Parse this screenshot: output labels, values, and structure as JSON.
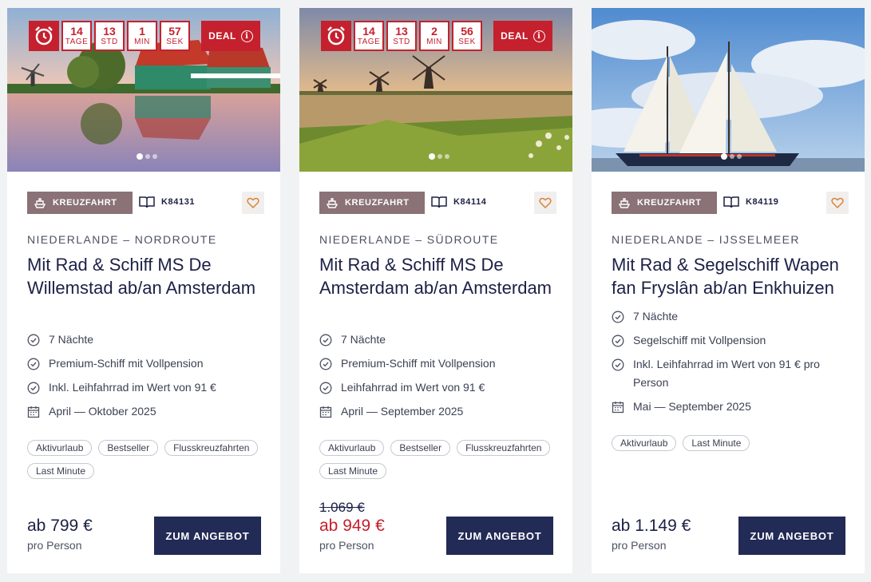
{
  "colors": {
    "accent_red": "#c5202d",
    "navy": "#222a56",
    "badge_brown": "#8a7276"
  },
  "cards": [
    {
      "countdown": {
        "days": "14",
        "days_label": "TAGE",
        "hours": "13",
        "hours_label": "STD",
        "minutes": "1",
        "minutes_label": "MIN",
        "seconds": "57",
        "seconds_label": "SEK"
      },
      "deal_label": "DEAL",
      "image_icon": "windmill-village-photo",
      "category": "KREUZFAHRT",
      "code": "K84131",
      "region": "NIEDERLANDE – NORDROUTE",
      "title": "Mit Rad & Schiff MS De Willemstad ab/an Amsterdam",
      "features": [
        {
          "icon": "check-circle-icon",
          "text": "7 Nächte"
        },
        {
          "icon": "check-circle-icon",
          "text": "Premium-Schiff mit Vollpension"
        },
        {
          "icon": "check-circle-icon",
          "text": "Inkl. Leihfahrrad im Wert von 91 €"
        },
        {
          "icon": "calendar-icon",
          "text": "April — Oktober 2025"
        }
      ],
      "tags": [
        "Aktivurlaub",
        "Bestseller",
        "Flusskreuzfahrten",
        "Last Minute"
      ],
      "old_price": "",
      "price": "ab 799 €",
      "per_person": "pro Person",
      "cta": "ZUM ANGEBOT"
    },
    {
      "countdown": {
        "days": "14",
        "days_label": "TAGE",
        "hours": "13",
        "hours_label": "STD",
        "minutes": "2",
        "minutes_label": "MIN",
        "seconds": "56",
        "seconds_label": "SEK"
      },
      "deal_label": "DEAL",
      "image_icon": "windmills-river-photo",
      "category": "KREUZFAHRT",
      "code": "K84114",
      "region": "NIEDERLANDE – SÜDROUTE",
      "title": "Mit Rad & Schiff MS De Amsterdam ab/an Amsterdam",
      "features": [
        {
          "icon": "check-circle-icon",
          "text": "7 Nächte"
        },
        {
          "icon": "check-circle-icon",
          "text": "Premium-Schiff mit Vollpension"
        },
        {
          "icon": "check-circle-icon",
          "text": "Leihfahrrad im Wert von 91 €"
        },
        {
          "icon": "calendar-icon",
          "text": "April — September 2025"
        }
      ],
      "tags": [
        "Aktivurlaub",
        "Bestseller",
        "Flusskreuzfahrten",
        "Last Minute"
      ],
      "old_price": "1.069 €",
      "price": "ab 949 €",
      "per_person": "pro Person",
      "cta": "ZUM ANGEBOT"
    },
    {
      "image_icon": "sailing-ship-photo",
      "category": "KREUZFAHRT",
      "code": "K84119",
      "region": "NIEDERLANDE – IJSSELMEER",
      "title": "Mit Rad & Segelschiff Wapen fan Fryslân ab/an Enkhuizen",
      "features": [
        {
          "icon": "check-circle-icon",
          "text": "7 Nächte"
        },
        {
          "icon": "check-circle-icon",
          "text": "Segelschiff mit Vollpension"
        },
        {
          "icon": "check-circle-icon",
          "text": "Inkl. Leihfahrrad im Wert von 91 € pro Person"
        },
        {
          "icon": "calendar-icon",
          "text": "Mai — September 2025"
        }
      ],
      "tags": [
        "Aktivurlaub",
        "Last Minute"
      ],
      "old_price": "",
      "price": "ab 1.149 €",
      "per_person": "pro Person",
      "cta": "ZUM ANGEBOT"
    }
  ]
}
